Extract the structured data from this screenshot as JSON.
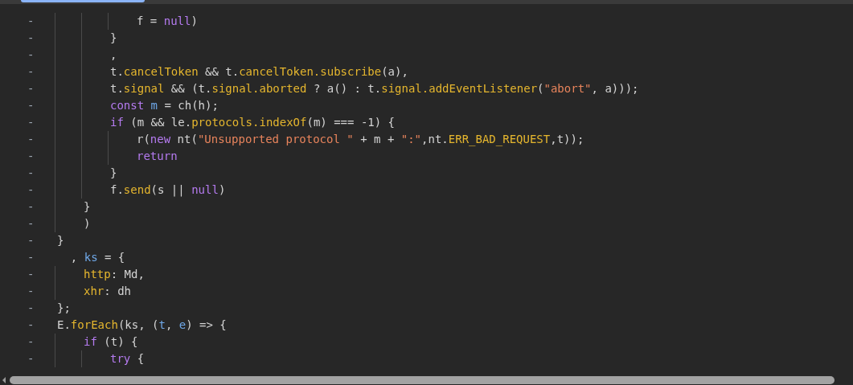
{
  "editor": {
    "lines": [
      {
        "kind": "block",
        "children": [
          {
            "kind": "block",
            "children": [
              {
                "kind": "block",
                "children": [
                  {
                    "kind": "line",
                    "marker": "-",
                    "tokens": [
                      {
                        "text": "f = ",
                        "kind": "plain"
                      },
                      {
                        "text": "null",
                        "kind": "keyword"
                      },
                      {
                        "text": ")",
                        "kind": "plain"
                      }
                    ]
                  }
                ]
              },
              {
                "kind": "line",
                "marker": "-",
                "tokens": [
                  {
                    "text": "}",
                    "kind": "plain"
                  }
                ]
              },
              {
                "kind": "line",
                "marker": "-",
                "tokens": [
                  {
                    "text": ",",
                    "kind": "plain"
                  }
                ]
              },
              {
                "kind": "line",
                "marker": "-",
                "tokens": [
                  {
                    "text": "t.",
                    "kind": "plain"
                  },
                  {
                    "text": "cancelToken",
                    "kind": "prop"
                  },
                  {
                    "text": " && t.",
                    "kind": "plain"
                  },
                  {
                    "text": "cancelToken.",
                    "kind": "prop"
                  },
                  {
                    "text": "subscribe",
                    "kind": "prop"
                  },
                  {
                    "text": "(a),",
                    "kind": "plain"
                  }
                ]
              },
              {
                "kind": "line",
                "marker": "-",
                "tokens": [
                  {
                    "text": "t.",
                    "kind": "plain"
                  },
                  {
                    "text": "signal",
                    "kind": "prop"
                  },
                  {
                    "text": " && (t.",
                    "kind": "plain"
                  },
                  {
                    "text": "signal.",
                    "kind": "prop"
                  },
                  {
                    "text": "aborted",
                    "kind": "prop"
                  },
                  {
                    "text": " ? a() : t.",
                    "kind": "plain"
                  },
                  {
                    "text": "signal.",
                    "kind": "prop"
                  },
                  {
                    "text": "addEventListener",
                    "kind": "prop"
                  },
                  {
                    "text": "(",
                    "kind": "plain"
                  },
                  {
                    "text": "\"abort\"",
                    "kind": "string"
                  },
                  {
                    "text": ", a)));",
                    "kind": "plain"
                  }
                ]
              },
              {
                "kind": "line",
                "marker": "-",
                "tokens": [
                  {
                    "text": "const ",
                    "kind": "keyword"
                  },
                  {
                    "text": "m",
                    "kind": "var"
                  },
                  {
                    "text": " = ch(h);",
                    "kind": "plain"
                  }
                ]
              },
              {
                "kind": "line",
                "marker": "-",
                "tokens": [
                  {
                    "text": "if",
                    "kind": "keyword"
                  },
                  {
                    "text": " (m && le.",
                    "kind": "plain"
                  },
                  {
                    "text": "protocols.",
                    "kind": "prop"
                  },
                  {
                    "text": "indexOf",
                    "kind": "prop"
                  },
                  {
                    "text": "(m) === -1) {",
                    "kind": "plain"
                  }
                ]
              },
              {
                "kind": "block",
                "children": [
                  {
                    "kind": "line",
                    "marker": "-",
                    "tokens": [
                      {
                        "text": "r(",
                        "kind": "plain"
                      },
                      {
                        "text": "new",
                        "kind": "keyword"
                      },
                      {
                        "text": " nt(",
                        "kind": "plain"
                      },
                      {
                        "text": "\"Unsupported protocol \"",
                        "kind": "string"
                      },
                      {
                        "text": " + m + ",
                        "kind": "plain"
                      },
                      {
                        "text": "\":\"",
                        "kind": "string"
                      },
                      {
                        "text": ",nt.",
                        "kind": "plain"
                      },
                      {
                        "text": "ERR_BAD_REQUEST",
                        "kind": "prop"
                      },
                      {
                        "text": ",t));",
                        "kind": "plain"
                      }
                    ]
                  },
                  {
                    "kind": "line",
                    "marker": "-",
                    "tokens": [
                      {
                        "text": "return",
                        "kind": "keyword"
                      }
                    ]
                  }
                ]
              },
              {
                "kind": "line",
                "marker": "-",
                "tokens": [
                  {
                    "text": "}",
                    "kind": "plain"
                  }
                ]
              },
              {
                "kind": "line",
                "marker": "-",
                "tokens": [
                  {
                    "text": "f.",
                    "kind": "plain"
                  },
                  {
                    "text": "send",
                    "kind": "prop"
                  },
                  {
                    "text": "(s || ",
                    "kind": "plain"
                  },
                  {
                    "text": "null",
                    "kind": "keyword"
                  },
                  {
                    "text": ")",
                    "kind": "plain"
                  }
                ]
              }
            ]
          },
          {
            "kind": "line",
            "marker": "-",
            "tokens": [
              {
                "text": "}",
                "kind": "plain"
              }
            ]
          },
          {
            "kind": "line",
            "marker": "-",
            "tokens": [
              {
                "text": ")",
                "kind": "plain"
              }
            ]
          }
        ]
      },
      {
        "kind": "line",
        "marker": "-",
        "tokens": [
          {
            "text": "}",
            "kind": "plain"
          }
        ]
      },
      {
        "kind": "line",
        "marker": "-",
        "tokens": [
          {
            "text": "  , ",
            "kind": "plain"
          },
          {
            "text": "ks",
            "kind": "var"
          },
          {
            "text": " = {",
            "kind": "plain"
          }
        ]
      },
      {
        "kind": "block",
        "children": [
          {
            "kind": "line",
            "marker": "-",
            "tokens": [
              {
                "text": "http",
                "kind": "prop"
              },
              {
                "text": ": Md,",
                "kind": "plain"
              }
            ]
          },
          {
            "kind": "line",
            "marker": "-",
            "tokens": [
              {
                "text": "xhr",
                "kind": "prop"
              },
              {
                "text": ": dh",
                "kind": "plain"
              }
            ]
          }
        ]
      },
      {
        "kind": "line",
        "marker": "-",
        "tokens": [
          {
            "text": "};",
            "kind": "plain"
          }
        ]
      },
      {
        "kind": "line",
        "marker": "-",
        "tokens": [
          {
            "text": "E.",
            "kind": "plain"
          },
          {
            "text": "forEach",
            "kind": "prop"
          },
          {
            "text": "(ks, (",
            "kind": "plain"
          },
          {
            "text": "t",
            "kind": "var"
          },
          {
            "text": ", ",
            "kind": "plain"
          },
          {
            "text": "e",
            "kind": "var"
          },
          {
            "text": ") => {",
            "kind": "plain"
          }
        ]
      },
      {
        "kind": "block",
        "children": [
          {
            "kind": "line",
            "marker": "-",
            "tokens": [
              {
                "text": "if",
                "kind": "keyword"
              },
              {
                "text": " (t) {",
                "kind": "plain"
              }
            ]
          },
          {
            "kind": "block",
            "children": [
              {
                "kind": "line",
                "marker": "-",
                "tokens": [
                  {
                    "text": "try",
                    "kind": "keyword"
                  },
                  {
                    "text": " {",
                    "kind": "plain"
                  }
                ]
              }
            ]
          }
        ]
      }
    ]
  }
}
